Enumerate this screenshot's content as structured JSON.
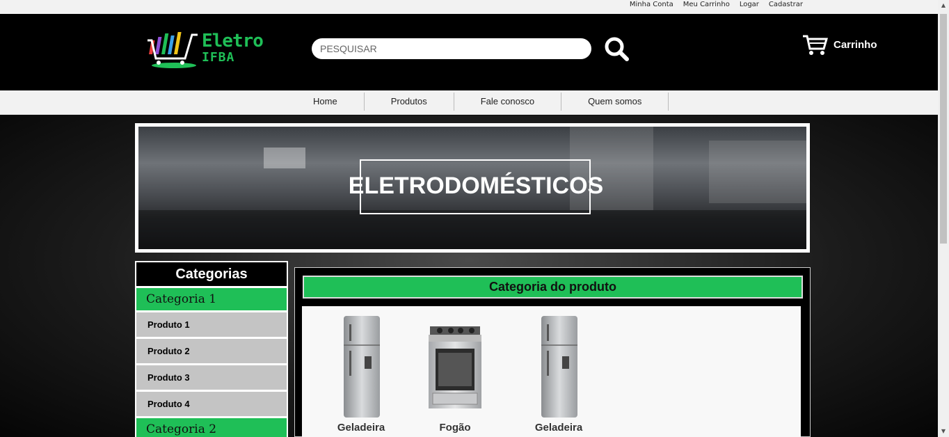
{
  "topbar": {
    "links": [
      "Minha Conta",
      "Meu Carrinho",
      "Logar",
      "Cadastrar"
    ]
  },
  "header": {
    "logo": {
      "line1": "Eletro",
      "line2": "IFBA"
    },
    "search_placeholder": "PESQUISAR",
    "cart_label": "Carrinho"
  },
  "nav": {
    "items": [
      "Home",
      "Produtos",
      "Fale conosco",
      "Quem somos"
    ]
  },
  "banner": {
    "title": "ELETRODOMÉSTICOS"
  },
  "sidebar": {
    "title": "Categorias",
    "category1": "Categoria 1",
    "products": [
      "Produto 1",
      "Produto 2",
      "Produto 3",
      "Produto 4"
    ],
    "category2": "Categoria 2"
  },
  "content": {
    "title": "Categoria do produto",
    "products": [
      {
        "name": "Geladeira",
        "icon": "refrigerator-icon"
      },
      {
        "name": "Fogão",
        "icon": "stove-icon"
      },
      {
        "name": "Geladeira",
        "icon": "refrigerator-icon"
      }
    ]
  },
  "colors": {
    "accent": "#1fbf57",
    "header_bg": "#000000",
    "nav_bg": "#f2f2f2",
    "sidebar_item": "#c4c4c4"
  }
}
